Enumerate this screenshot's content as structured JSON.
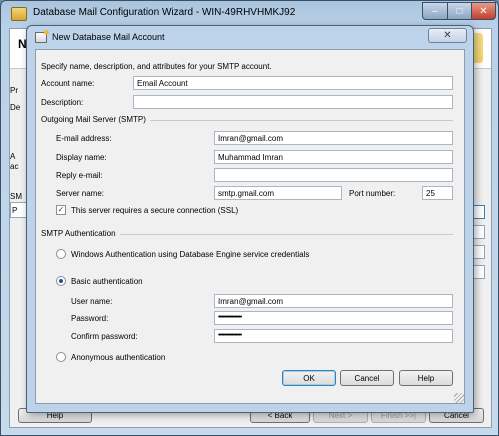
{
  "outer_window": {
    "title": "Database Mail Configuration Wizard - WIN-49RHVHMKJ92",
    "header_title": "N",
    "ghost_labels": [
      "Pr",
      "De",
      "A",
      "ac",
      "SM",
      "P"
    ],
    "buttons": {
      "help": "Help",
      "back": "< Back",
      "next": "Next >",
      "finish": "Finish >>|",
      "cancel": "Cancel"
    },
    "window_controls": {
      "minimize": "–",
      "maximize": "□",
      "close": "✕"
    }
  },
  "dialog": {
    "title": "New Database Mail Account",
    "close_glyph": "✕",
    "intro": "Specify name, description, and attributes for your SMTP account.",
    "account_name_label": "Account name:",
    "account_name_value": "Email Account",
    "description_label": "Description:",
    "description_value": "",
    "smtp_group": "Outgoing Mail Server (SMTP)",
    "email_label": "E-mail address:",
    "email_value": "Imran@gmail.com",
    "display_name_label": "Display name:",
    "display_name_value": "Muhammad Imran",
    "reply_email_label": "Reply e-mail:",
    "reply_email_value": "",
    "server_name_label": "Server name:",
    "server_name_value": "smtp.gmail.com",
    "port_label": "Port number:",
    "port_value": "25",
    "ssl_label": "This server requires a secure connection (SSL)",
    "ssl_checked": true,
    "auth_group": "SMTP Authentication",
    "auth_options": {
      "windows": "Windows Authentication using Database Engine service credentials",
      "basic": "Basic authentication",
      "anonymous": "Anonymous authentication"
    },
    "selected_auth": "basic",
    "username_label": "User name:",
    "username_value": "Imran@gmail.com",
    "password_label": "Password:",
    "password_value": "••••••••••••••••",
    "confirm_password_label": "Confirm password:",
    "confirm_password_value": "••••••••••••••••",
    "buttons": {
      "ok": "OK",
      "cancel": "Cancel",
      "help": "Help"
    }
  },
  "colors": {
    "titlebar": "#b9d1e8",
    "dialog_body": "#f0f0f0",
    "close_red": "#c0402a",
    "default_button_border": "#3c7fb1"
  }
}
